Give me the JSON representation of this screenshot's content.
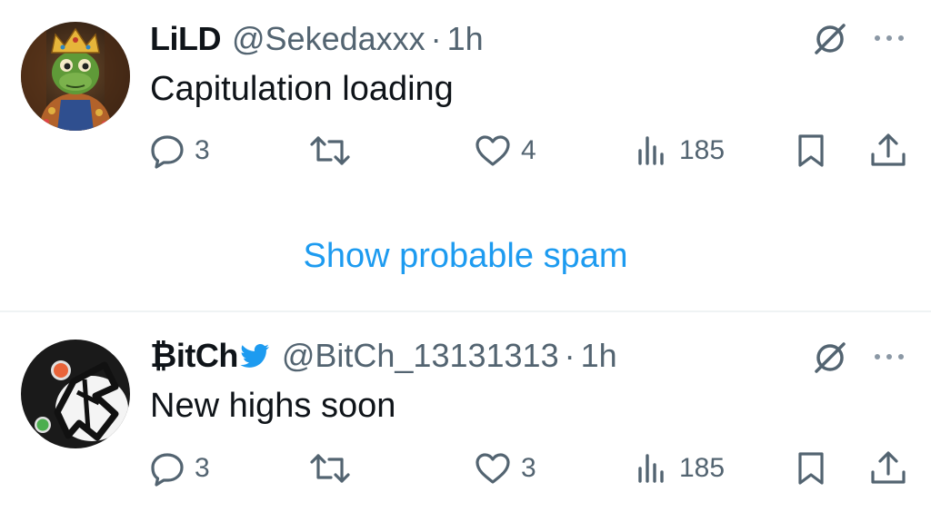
{
  "tweets": [
    {
      "display_name": "LiLD",
      "handle": "@Sekedaxxx",
      "separator": "·",
      "time": "1h",
      "text": "Capitulation loading",
      "replies": "3",
      "retweets": "",
      "likes": "4",
      "views": "185"
    },
    {
      "display_name": "₿itCh",
      "verified_icon": "twitter-bird-icon",
      "handle": "@BitCh_13131313",
      "separator": "·",
      "time": "1h",
      "text": "New highs soon",
      "replies": "3",
      "retweets": "",
      "likes": "3",
      "views": "185"
    }
  ],
  "spam": {
    "label": "Show probable spam"
  },
  "colors": {
    "text_primary": "#0f1419",
    "text_secondary": "#536471",
    "link": "#1d9bf0",
    "divider": "#eff3f4"
  }
}
